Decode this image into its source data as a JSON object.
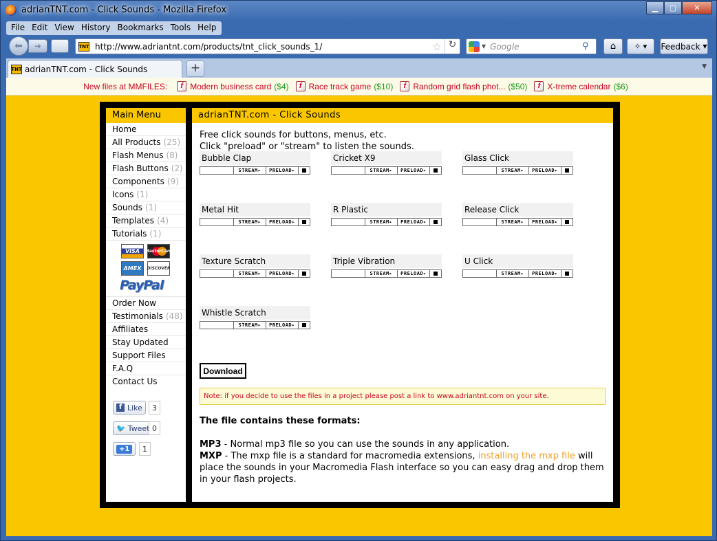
{
  "window": {
    "title": "adrianTNT.com - Click Sounds - Mozilla Firefox"
  },
  "menu": [
    "File",
    "Edit",
    "View",
    "History",
    "Bookmarks",
    "Tools",
    "Help"
  ],
  "nav": {
    "url": "http://www.adriantnt.com/products/tnt_click_sounds_1/",
    "search_placeholder": "Google",
    "feedback_label": "Feedback",
    "favicon_text": "TNT"
  },
  "tab": {
    "title": "adrianTNT.com - Click Sounds",
    "new_tab": "+"
  },
  "notify": {
    "label": "New files at MMFILES:",
    "items": [
      {
        "name": "Modern business card",
        "price": "($4)"
      },
      {
        "name": "Race track game",
        "price": "($10)"
      },
      {
        "name": "Random grid flash phot...",
        "price": "($50)"
      },
      {
        "name": "X-treme calendar",
        "price": "($6)"
      }
    ]
  },
  "sidebar": {
    "heading": "Main Menu",
    "items_top": [
      {
        "label": "Home",
        "count": ""
      },
      {
        "label": "All Products",
        "count": "(25)"
      },
      {
        "label": "Flash Menus",
        "count": "(8)"
      },
      {
        "label": "Flash Buttons",
        "count": "(2)"
      },
      {
        "label": "Components",
        "count": "(9)"
      },
      {
        "label": "Icons",
        "count": "(1)"
      },
      {
        "label": "Sounds",
        "count": "(1)"
      },
      {
        "label": "Templates",
        "count": "(4)"
      },
      {
        "label": "Tutorials",
        "count": "(1)"
      }
    ],
    "cards": {
      "visa": "VISA",
      "mastercard": "MasterCard",
      "amex": "AMEX",
      "discover": "DISCOVER",
      "paypal": "PayPal"
    },
    "items_bottom": [
      {
        "label": "Order Now",
        "count": ""
      },
      {
        "label": "Testimonials",
        "count": "(48)"
      },
      {
        "label": "Affiliates",
        "count": ""
      },
      {
        "label": "Stay Updated",
        "count": ""
      },
      {
        "label": "Support Files",
        "count": ""
      },
      {
        "label": "F.A.Q",
        "count": ""
      },
      {
        "label": "Contact Us",
        "count": ""
      }
    ],
    "social": {
      "like_label": "Like",
      "like_count": "3",
      "tweet_label": "Tweet",
      "tweet_count": "0",
      "plusone_label": "+1",
      "plusone_count": "1"
    }
  },
  "main": {
    "heading": "adrianTNT.com - Click Sounds",
    "intro_line1": "Free click sounds for buttons, menus, etc.",
    "intro_line2": "Click \"preload\" or \"stream\" to listen the sounds.",
    "player": {
      "stream": "STREAM▸",
      "preload": "PRELOAD▸"
    },
    "sounds": [
      "Bubble Clap",
      "Cricket X9",
      "Glass Click",
      "Metal Hit",
      "R Plastic",
      "Release Click",
      "Texture Scratch",
      "Triple Vibration",
      "U Click",
      "Whistle Scratch"
    ],
    "download_label": "Download",
    "note": "Note: if you decide to use the files in a project please post a link to www.adriantnt.com on your site.",
    "formats_title": "The file contains these formats:",
    "mp3_label": "MP3",
    "mp3_text": " - Normal mp3 file so you can use the sounds in any application.",
    "mxp_label": "MXP",
    "mxp_text_a": " - The mxp file is a standard for macromedia extensions, ",
    "mxp_link": "installing the mxp file",
    "mxp_text_b": " will place the sounds in your Macromedia Flash interface so you can easy drag and drop them in your flash projects."
  },
  "colors": {
    "accent": "#f9c600",
    "alert_red": "#c8001e",
    "price_green": "#1a9a1a",
    "link_orange": "#f0a22a"
  }
}
